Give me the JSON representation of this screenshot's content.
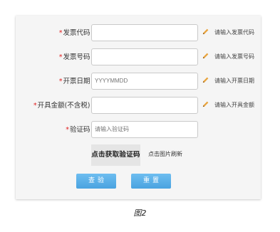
{
  "form": {
    "required_mark": "*",
    "fields": [
      {
        "label": "发票代码：",
        "value": "",
        "placeholder": "",
        "hint": "请输入发票代码"
      },
      {
        "label": "发票号码：",
        "value": "",
        "placeholder": "",
        "hint": "请输入发票号码"
      },
      {
        "label": "开票日期：",
        "value": "",
        "placeholder": "YYYYMMDD",
        "hint": "请输入开票日期"
      },
      {
        "label": "开具金额(不含税)：",
        "value": "",
        "placeholder": "",
        "hint": "请输入开具金额"
      },
      {
        "label": "验证码：",
        "value": "",
        "placeholder": "请输入验证码",
        "hint": ""
      }
    ],
    "captcha_text": "点击获取验证码",
    "refresh_text": "点击图片刷新",
    "query_label": "查验",
    "reset_label": "重置",
    "button_color": "#4aa3e0",
    "pencil_color": "#e8a33d"
  },
  "caption": "图2"
}
